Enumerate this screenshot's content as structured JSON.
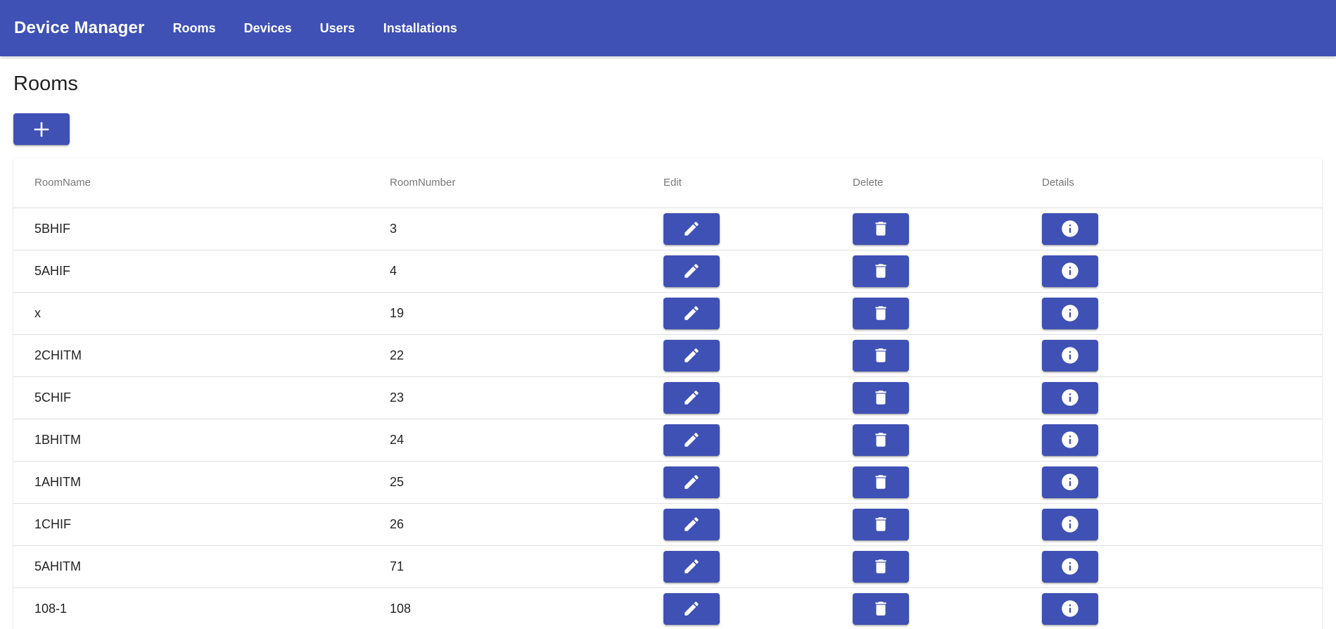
{
  "app": {
    "title": "Device Manager"
  },
  "nav": [
    {
      "label": "Rooms"
    },
    {
      "label": "Devices"
    },
    {
      "label": "Users"
    },
    {
      "label": "Installations"
    }
  ],
  "page": {
    "title": "Rooms",
    "add_icon": "plus-icon"
  },
  "table": {
    "headers": [
      "RoomName",
      "RoomNumber",
      "Edit",
      "Delete",
      "Details"
    ],
    "action_icons": {
      "edit": "pencil-icon",
      "delete": "trash-icon",
      "details": "info-icon"
    },
    "rows": [
      {
        "name": "5BHIF",
        "number": "3"
      },
      {
        "name": "5AHIF",
        "number": "4"
      },
      {
        "name": "x",
        "number": "19"
      },
      {
        "name": "2CHITM",
        "number": "22"
      },
      {
        "name": "5CHIF",
        "number": "23"
      },
      {
        "name": "1BHITM",
        "number": "24"
      },
      {
        "name": "1AHITM",
        "number": "25"
      },
      {
        "name": "1CHIF",
        "number": "26"
      },
      {
        "name": "5AHITM",
        "number": "71"
      },
      {
        "name": "108-1",
        "number": "108"
      }
    ]
  },
  "colors": {
    "primary": "#3f51b5",
    "on_primary": "#ffffff"
  }
}
